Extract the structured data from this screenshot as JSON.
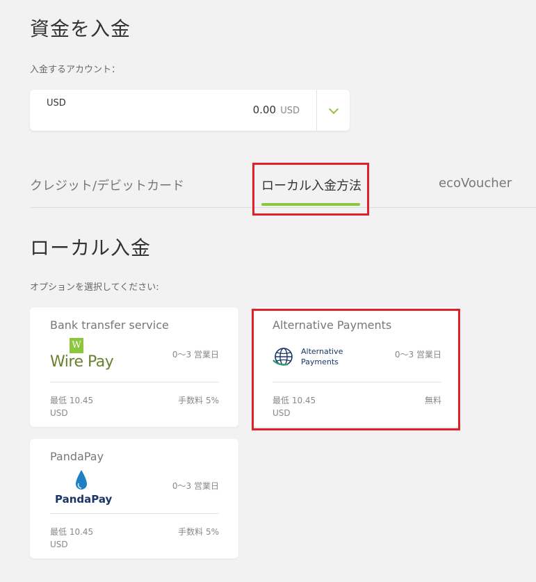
{
  "header": {
    "title": "資金を入金"
  },
  "account": {
    "label": "入金するアカウント：",
    "currency": "USD",
    "amount": "0.00",
    "amount_currency": "USD"
  },
  "tabs": [
    {
      "label": "クレジット/デビットカード",
      "active": false
    },
    {
      "label": "ローカル入金方法",
      "active": true
    },
    {
      "label": "ecoVoucher",
      "active": false
    }
  ],
  "section": {
    "title": "ローカル入金",
    "option_label": "オプションを選択してください:"
  },
  "cards": [
    {
      "title": "Bank transfer service",
      "logo_text": "Wire Pay",
      "logo_mark": "W",
      "days": "0〜3 営業日",
      "min_amount": "最低 10.45",
      "min_currency": "USD",
      "fee": "手数料 5%"
    },
    {
      "title": "Alternative Payments",
      "logo_text_line1": "Alternative",
      "logo_text_line2": "Payments",
      "days": "0〜3 営業日",
      "min_amount": "最低 10.45",
      "min_currency": "USD",
      "fee": "無料"
    },
    {
      "title": "PandaPay",
      "logo_text": "PandaPay",
      "days": "0〜3 営業日",
      "min_amount": "最低 10.45",
      "min_currency": "USD",
      "fee": "手数料 5%"
    }
  ],
  "colors": {
    "accent": "#8cc63f",
    "highlight": "#e0202b",
    "background": "#f2f2f2"
  },
  "icons": [
    "chevron-down-icon",
    "wirepay-logo",
    "globe-icon",
    "water-drop-icon"
  ]
}
